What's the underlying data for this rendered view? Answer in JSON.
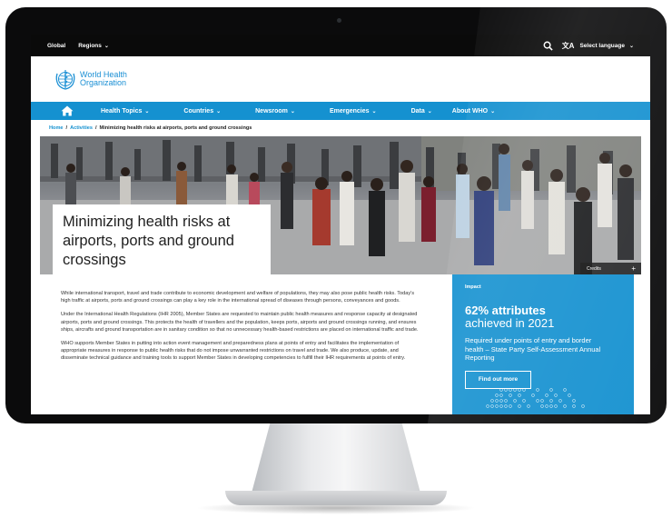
{
  "topbar": {
    "global_label": "Global",
    "regions_label": "Regions",
    "select_language_label": "Select language",
    "translate_icon": "文A"
  },
  "logo": {
    "line1": "World Health",
    "line2": "Organization"
  },
  "nav": {
    "items": [
      {
        "label": "Health Topics"
      },
      {
        "label": "Countries"
      },
      {
        "label": "Newsroom"
      },
      {
        "label": "Emergencies"
      },
      {
        "label": "Data"
      },
      {
        "label": "About WHO"
      }
    ]
  },
  "breadcrumb": {
    "home": "Home",
    "activities": "Activities",
    "current": "Minimizing health risks at airports, ports and ground crossings",
    "separator": "/"
  },
  "hero": {
    "title": "Minimizing health risks at airports, ports and ground crossings",
    "credits_label": "Credits",
    "credits_plus": "+"
  },
  "content": {
    "paragraphs": [
      "While international transport, travel and trade contribute to economic development and welfare of populations, they may also pose public health risks. Today's high traffic at airports, ports and ground crossings can play a key role in the international spread of diseases through persons, conveyances and goods.",
      "Under the International Health Regulations (IHR 2005), Member States are requested to maintain public health measures and response capacity at designated airports, ports and ground crossings. This protects the health of travellers and the population, keeps ports, airports and ground crossings running, and ensures ships, aircrafts and ground transportation are in sanitary condition so that no unnecessary health-based restrictions are placed on international traffic and trade.",
      "WHO supports Member States in putting into action event management and preparedness plans at points of entry and facilitates the implementation of appropriate measures in response to public health risks that do not impose unwarranted restrictions on travel and trade. We also produce, update, and disseminate technical guidance and training tools to support Member States in developing competencies to fulfill their IHR requirements at points of entry."
    ]
  },
  "impact": {
    "label": "Impact",
    "headline": "62% attributes",
    "subheadline": "achieved in 2021",
    "description": "Required under points of entry and border health – State Party Self-Assessment Annual Reporting",
    "button_label": "Find out more"
  },
  "colors": {
    "brand_blue": "#1591d0",
    "topbar_black": "#0a0a0a"
  }
}
